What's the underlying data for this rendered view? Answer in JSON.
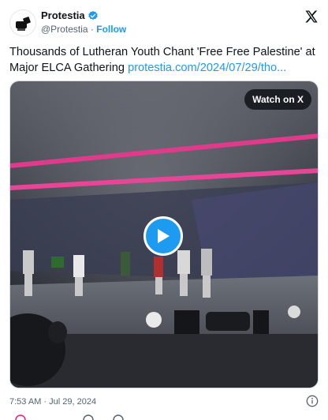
{
  "account": {
    "display_name": "Protestia",
    "handle": "@Protestia",
    "separator": "·",
    "follow_label": "Follow",
    "avatar_icon": "protestia-logo-icon",
    "verified_icon": "verified-badge-icon",
    "brand_color": "#1d9bf0"
  },
  "tweet": {
    "text": "Thousands of Lutheran Youth Chant 'Free Free Palestine' at Major ELCA Gathering ",
    "link_text": "protestia.com/2024/07/29/tho..."
  },
  "media": {
    "watch_label": "Watch on X",
    "play_icon": "play-icon"
  },
  "footer": {
    "timestamp": "7:53 AM · Jul 29, 2024",
    "info_icon": "info-icon"
  },
  "platform": {
    "logo_icon": "x-logo-icon"
  }
}
